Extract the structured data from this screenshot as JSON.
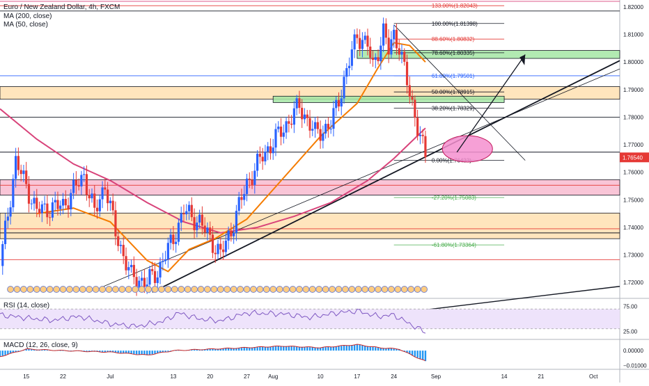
{
  "header": {
    "title": "Euro / New Zealand Dollar, 4h, FXCM",
    "ma200_label": "MA (200, close)",
    "ma50_label": "MA (50, close)",
    "rsi_label": "RSI (14, close)",
    "macd_label": "MACD (12, 26, close, 9)"
  },
  "colors": {
    "candle_up": "#2962ff",
    "candle_down": "#e53935",
    "ma50": "#f57c00",
    "ma200": "#d8437a",
    "orange_zone": "#ffe0b2",
    "pink_zone": "#f8bbd0",
    "green_zone": "#a5e6a5",
    "macd_hist": "#2196f3",
    "rsi_band": "#eee3fb"
  },
  "chart_data": {
    "type": "candlestick",
    "title": "Euro / New Zealand Dollar, 4h, FXCM",
    "ylim": [
      1.7145,
      1.8225
    ],
    "y_ticks": [
      "1.82000",
      "1.81000",
      "1.80000",
      "1.79000",
      "1.78000",
      "1.77000",
      "1.76000",
      "1.75000",
      "1.74000",
      "1.73000",
      "1.72000"
    ],
    "x_ticks": [
      "15",
      "22",
      "Jul",
      "13",
      "20",
      "27",
      "Aug",
      "10",
      "17",
      "24",
      "Sep",
      "14",
      "21",
      "Oct"
    ],
    "last_price": "1.76540",
    "price_path": [
      [
        "Jun 10",
        1.726
      ],
      [
        "Jun 13",
        1.764
      ],
      [
        "Jun 17",
        1.746
      ],
      [
        "Jun 22",
        1.748
      ],
      [
        "Jun 26",
        1.759
      ],
      [
        "Jun 28",
        1.745
      ],
      [
        "Jun 30",
        1.756
      ],
      [
        "Jul 2",
        1.738
      ],
      [
        "Jul 5",
        1.722
      ],
      [
        "Jul 8",
        1.72
      ],
      [
        "Jul 10",
        1.724
      ],
      [
        "Jul 13",
        1.736
      ],
      [
        "Jul 15",
        1.746
      ],
      [
        "Jul 18",
        1.742
      ],
      [
        "Jul 20",
        1.736
      ],
      [
        "Jul 22",
        1.73
      ],
      [
        "Jul 24",
        1.739
      ],
      [
        "Jul 27",
        1.756
      ],
      [
        "Jul 30",
        1.766
      ],
      [
        "Aug 3",
        1.776
      ],
      [
        "Aug 6",
        1.784
      ],
      [
        "Aug 9",
        1.774
      ],
      [
        "Aug 12",
        1.777
      ],
      [
        "Aug 14",
        1.79
      ],
      [
        "Aug 17",
        1.81
      ],
      [
        "Aug 19",
        1.806
      ],
      [
        "Aug 20",
        1.798
      ],
      [
        "Aug 22",
        1.811
      ],
      [
        "Aug 23",
        1.804
      ],
      [
        "Aug 24",
        1.81
      ],
      [
        "Aug 25",
        1.806
      ],
      [
        "Aug 26",
        1.797
      ],
      [
        "Aug 27",
        1.788
      ],
      [
        "Aug 28",
        1.781
      ],
      [
        "Aug 30",
        1.765
      ]
    ],
    "ma50_path": [
      [
        "Jun 17",
        1.745
      ],
      [
        "Jun 24",
        1.747
      ],
      [
        "Jul 1",
        1.742
      ],
      [
        "Jul 8",
        1.728
      ],
      [
        "Jul 12",
        1.724
      ],
      [
        "Jul 16",
        1.732
      ],
      [
        "Jul 21",
        1.736
      ],
      [
        "Jul 27",
        1.743
      ],
      [
        "Aug 3",
        1.758
      ],
      [
        "Aug 10",
        1.773
      ],
      [
        "Aug 17",
        1.785
      ],
      [
        "Aug 21",
        1.798
      ],
      [
        "Aug 24",
        1.807
      ],
      [
        "Aug 27",
        1.806
      ],
      [
        "Aug 30",
        1.8
      ]
    ],
    "ma200_path": [
      [
        "Jun 10",
        1.783
      ],
      [
        "Jun 17",
        1.772
      ],
      [
        "Jun 24",
        1.763
      ],
      [
        "Jul 1",
        1.757
      ],
      [
        "Jul 8",
        1.749
      ],
      [
        "Jul 15",
        1.742
      ],
      [
        "Jul 22",
        1.738
      ],
      [
        "Jul 29",
        1.74
      ],
      [
        "Aug 5",
        1.744
      ],
      [
        "Aug 12",
        1.749
      ],
      [
        "Aug 19",
        1.757
      ],
      [
        "Aug 24",
        1.765
      ],
      [
        "Aug 30",
        1.776
      ]
    ],
    "fib_levels": [
      {
        "label": "133.00%(1.82043)",
        "value": 1.82043,
        "color": "#e53935",
        "from": "Jun 10"
      },
      {
        "label": "100.00%(1.81398)",
        "value": 1.81398,
        "color": "#131722",
        "from": "Aug 24"
      },
      {
        "label": "88.60%(1.80832)",
        "value": 1.80832,
        "color": "#e53935",
        "from": "Aug 24"
      },
      {
        "label": "78.60%(1.80335)",
        "value": 1.80335,
        "color": "#131722",
        "from": "Aug 24"
      },
      {
        "label": "61.80%(1.79501)",
        "value": 1.79501,
        "color": "#2962ff",
        "from": "Aug 24"
      },
      {
        "label": "50.00%(1.78915)",
        "value": 1.78915,
        "color": "#131722",
        "from": "Aug 24"
      },
      {
        "label": "38.20%(1.78329)",
        "value": 1.78329,
        "color": "#131722",
        "from": "Aug 24"
      },
      {
        "label": "0.00%(1.76433)",
        "value": 1.76433,
        "color": "#131722",
        "from": "Aug 24"
      },
      {
        "label": "-27.20%(1.75083)",
        "value": 1.75083,
        "color": "#4caf50",
        "from": "Aug 24"
      },
      {
        "label": "-61.80%(1.73364)",
        "value": 1.73364,
        "color": "#4caf50",
        "from": "Aug 24"
      }
    ],
    "zones": [
      {
        "kind": "green",
        "from": "Aug 17",
        "to": "Oct 6",
        "y0": 1.8013,
        "y1": 1.8042
      },
      {
        "kind": "orange",
        "from": "Jun 10",
        "to": "Oct 6",
        "y0": 1.7865,
        "y1": 1.7911
      },
      {
        "kind": "green",
        "from": "Aug 1",
        "to": "Sep 14",
        "y0": 1.7853,
        "y1": 1.7876
      },
      {
        "kind": "pink",
        "from": "Jun 10",
        "to": "Oct 6",
        "y0": 1.7517,
        "y1": 1.7573
      },
      {
        "kind": "orange",
        "from": "Jun 10",
        "to": "Oct 6",
        "y0": 1.7359,
        "y1": 1.7452
      }
    ],
    "horizontal_lines": [
      {
        "value": 1.822,
        "color": "#d8437a"
      },
      {
        "value": 1.8185,
        "color": "#131722"
      },
      {
        "value": 1.795,
        "color": "#2962ff"
      },
      {
        "value": 1.78,
        "color": "#131722"
      },
      {
        "value": 1.7673,
        "color": "#131722"
      },
      {
        "value": 1.7553,
        "color": "#e53935"
      },
      {
        "value": 1.7395,
        "color": "#e53935"
      },
      {
        "value": 1.738,
        "color": "#131722"
      },
      {
        "value": 1.7283,
        "color": "#e53935"
      }
    ],
    "rsi": {
      "y_ticks": [
        "75.00",
        "25.00"
      ],
      "path": [
        [
          "Jun 10",
          58
        ],
        [
          "Jun 15",
          52
        ],
        [
          "Jun 20",
          47
        ],
        [
          "Jun 25",
          55
        ],
        [
          "Jul 1",
          40
        ],
        [
          "Jul 6",
          35
        ],
        [
          "Jul 11",
          45
        ],
        [
          "Jul 14",
          62
        ],
        [
          "Jul 18",
          50
        ],
        [
          "Jul 22",
          46
        ],
        [
          "Jul 27",
          62
        ],
        [
          "Aug 3",
          60
        ],
        [
          "Aug 8",
          53
        ],
        [
          "Aug 13",
          62
        ],
        [
          "Aug 17",
          66
        ],
        [
          "Aug 21",
          55
        ],
        [
          "Aug 24",
          58
        ],
        [
          "Aug 27",
          40
        ],
        [
          "Aug 30",
          23
        ]
      ]
    },
    "macd": {
      "y_ticks": [
        "0.00000",
        "−0.01000"
      ],
      "path": [
        [
          "Jun 10",
          -0.004
        ],
        [
          "Jun 15",
          0.001
        ],
        [
          "Jun 22",
          0.0
        ],
        [
          "Jul 1",
          -0.001
        ],
        [
          "Jul 8",
          -0.003
        ],
        [
          "Jul 13",
          0.0
        ],
        [
          "Jul 20",
          0.001
        ],
        [
          "Jul 27",
          0.002
        ],
        [
          "Aug 3",
          0.003
        ],
        [
          "Aug 10",
          0.002
        ],
        [
          "Aug 17",
          0.004
        ],
        [
          "Aug 21",
          0.002
        ],
        [
          "Aug 25",
          0.001
        ],
        [
          "Aug 28",
          -0.004
        ],
        [
          "Aug 30",
          -0.007
        ]
      ]
    }
  }
}
